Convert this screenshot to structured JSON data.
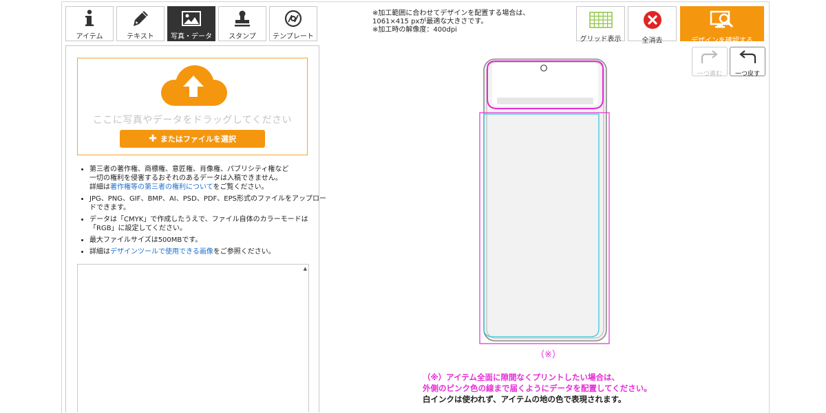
{
  "tabs": [
    {
      "label": "アイテム",
      "icon": "info-icon",
      "active": false
    },
    {
      "label": "テキスト",
      "icon": "pen-icon",
      "active": false
    },
    {
      "label": "写真・データ",
      "icon": "image-icon",
      "active": true
    },
    {
      "label": "スタンプ",
      "icon": "stamp-icon",
      "active": false
    },
    {
      "label": "テンプレート",
      "icon": "template-icon",
      "active": false
    }
  ],
  "upload": {
    "drop_text": "ここに写真やデータをドラッグしてください",
    "file_button": "またはファイルを選択",
    "cloud_color": "#f5960f"
  },
  "notes": {
    "n1_line1": "第三者の著作権、商標権、意匠権、肖像権、パブリシティ権など",
    "n1_line2": "一切の権利を侵害するおそれのあるデータは入稿できません。",
    "n1_prefix": "詳細は",
    "n1_link": "著作権等の第三者の権利について",
    "n1_suffix": "をご覧ください。",
    "n2": "JPG、PNG、GIF、BMP、AI、PSD、PDF、EPS形式のファイルをアップロードできます。",
    "n3": "データは「CMYK」で作成したうえで、ファイル自体のカラーモードは「RGB」に設定してください。",
    "n4": "最大ファイルサイズは500MBです。",
    "n5_prefix": "詳細は",
    "n5_link": "デザインツールで使用できる画像",
    "n5_suffix": "をご参照ください。"
  },
  "info": {
    "line1": "※加工範囲に合わせてデザインを配置する場合は、",
    "line2": "1061×415 pxが最適な大きさです。",
    "line3": "※加工時の解像度：400dpi"
  },
  "toolbar": {
    "grid_label": "グリッド表示",
    "clear_label": "全消去",
    "confirm_label": "デザインを確認する",
    "redo_label": "一つ進む",
    "undo_label": "一つ戻す"
  },
  "canvas": {
    "mark": "（※）",
    "note_line1": "（※）アイテム全面に隙間なくプリントしたい場合は、",
    "note_line2": "外側のピンク色の線まで届くようにデータを配置してください。",
    "note_line3": "白インクは使われず、アイテムの地の色で表現されます。",
    "pink_color": "#e52cd6",
    "cyan_color": "#38c8d8"
  }
}
